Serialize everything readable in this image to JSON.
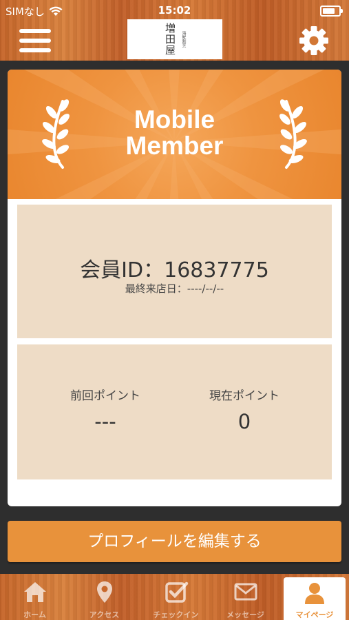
{
  "status_bar": {
    "carrier": "SIMなし",
    "time": "15:02"
  },
  "header": {
    "logo_main": "増田屋",
    "logo_sub": "海鮮割烹",
    "menu_icon": "hamburger-menu-icon",
    "settings_icon": "gear-icon"
  },
  "card": {
    "banner_line1": "Mobile",
    "banner_line2": "Member",
    "member_id_label": "会員ID：",
    "member_id_value": "16837775",
    "last_visit": "最終来店日：----/--/--",
    "prev_points_label": "前回ポイント",
    "prev_points_value": "---",
    "current_points_label": "現在ポイント",
    "current_points_value": "0"
  },
  "edit_profile_label": "プロフィールを編集する",
  "tabs": [
    {
      "label": "ホーム",
      "icon": "home-icon"
    },
    {
      "label": "アクセス",
      "icon": "map-pin-icon"
    },
    {
      "label": "チェックイン",
      "icon": "checkbox-icon"
    },
    {
      "label": "メッセージ",
      "icon": "envelope-icon"
    },
    {
      "label": "マイページ",
      "icon": "person-icon"
    }
  ],
  "colors": {
    "accent": "#e8923b",
    "panel": "#eedcc6",
    "active_tab_text": "#e8923b"
  }
}
